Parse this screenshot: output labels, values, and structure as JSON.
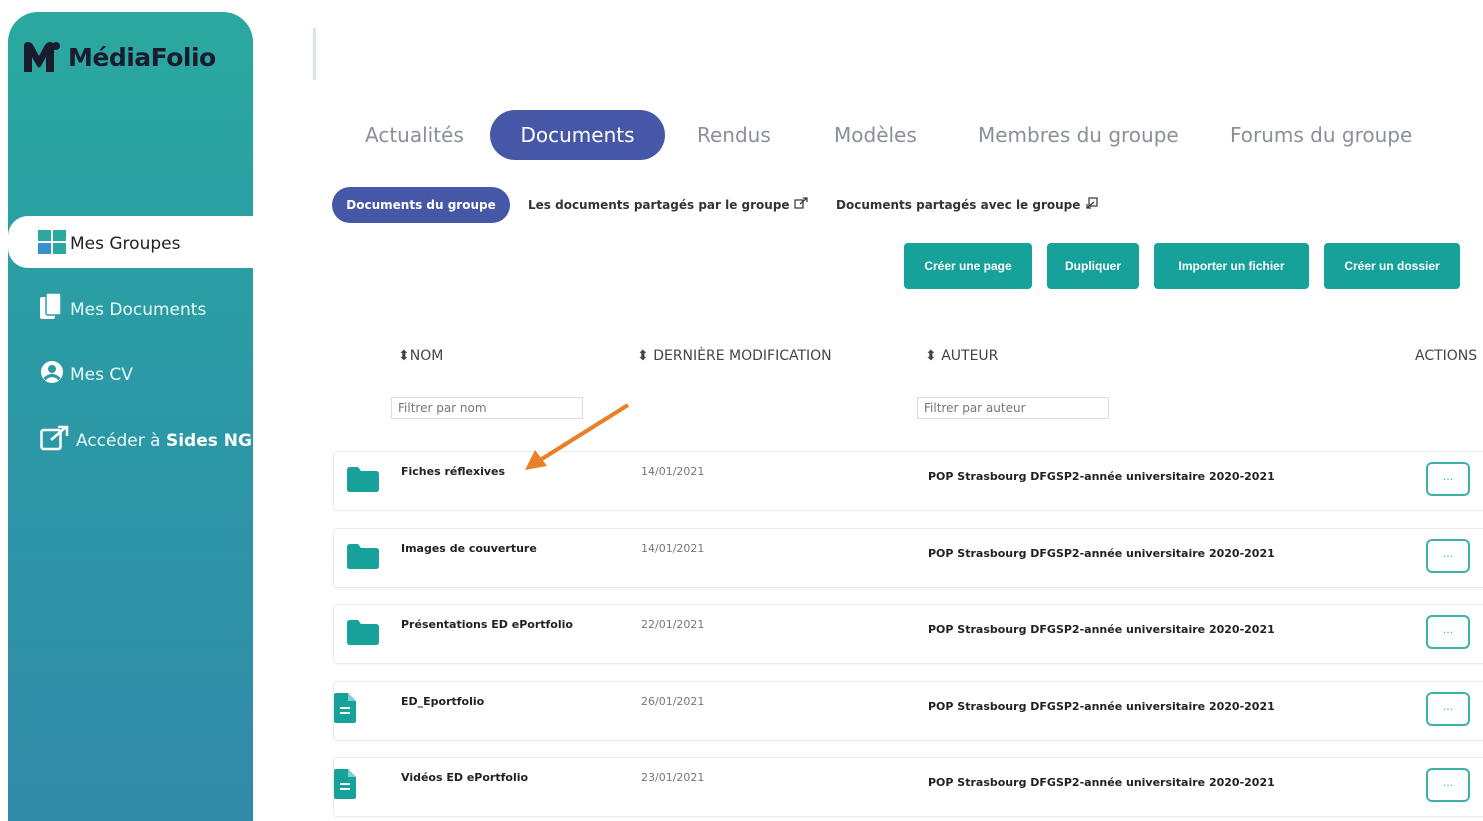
{
  "brand": {
    "name": "MédiaFolio"
  },
  "sidebar": {
    "items": [
      {
        "label": "Mes Groupes",
        "icon": "grid-icon",
        "active": true
      },
      {
        "label": "Mes Documents",
        "icon": "documents-icon"
      },
      {
        "label": "Mes CV",
        "icon": "user-circle-icon"
      },
      {
        "label_prefix": "Accéder à ",
        "label_bold": "Sides NG",
        "icon": "external-link-icon"
      }
    ]
  },
  "tabs": [
    {
      "label": "Actualités"
    },
    {
      "label": "Documents",
      "active": true
    },
    {
      "label": "Rendus"
    },
    {
      "label": "Modèles"
    },
    {
      "label": "Membres du groupe"
    },
    {
      "label": "Forums du groupe"
    }
  ],
  "subtabs": [
    {
      "label": "Documents du groupe",
      "active": true
    },
    {
      "label": "Les documents partagés par le groupe"
    },
    {
      "label": "Documents partagés avec le groupe"
    }
  ],
  "actions": {
    "create_page": "Créer une page",
    "duplicate": "Dupliquer",
    "import_file": "Importer un fichier",
    "create_folder": "Créer un dossier"
  },
  "table": {
    "headers": {
      "name": "NOM",
      "modified": "DERNIÈRE MODIFICATION",
      "author": "AUTEUR",
      "actions": "ACTIONS"
    },
    "filters": {
      "name_placeholder": "Filtrer par nom",
      "author_placeholder": "Filtrer par auteur"
    },
    "rows": [
      {
        "type": "folder",
        "name": "Fiches réflexives",
        "date": "14/01/2021",
        "author": "POP Strasbourg DFGSP2-année universitaire 2020-2021"
      },
      {
        "type": "folder",
        "name": "Images de couverture",
        "date": "14/01/2021",
        "author": "POP Strasbourg DFGSP2-année universitaire 2020-2021"
      },
      {
        "type": "folder",
        "name": "Présentations ED ePortfolio",
        "date": "22/01/2021",
        "author": "POP Strasbourg DFGSP2-année universitaire 2020-2021"
      },
      {
        "type": "file",
        "name": "ED_Eportfolio",
        "date": "26/01/2021",
        "author": "POP Strasbourg DFGSP2-année universitaire 2020-2021"
      },
      {
        "type": "file",
        "name": "Vidéos ED ePortfolio",
        "date": "23/01/2021",
        "author": "POP Strasbourg DFGSP2-année universitaire 2020-2021"
      }
    ],
    "row_action_label": "..."
  },
  "colors": {
    "primary": "#4657a8",
    "teal": "#16a29a",
    "annotation_arrow": "#e8802a"
  }
}
